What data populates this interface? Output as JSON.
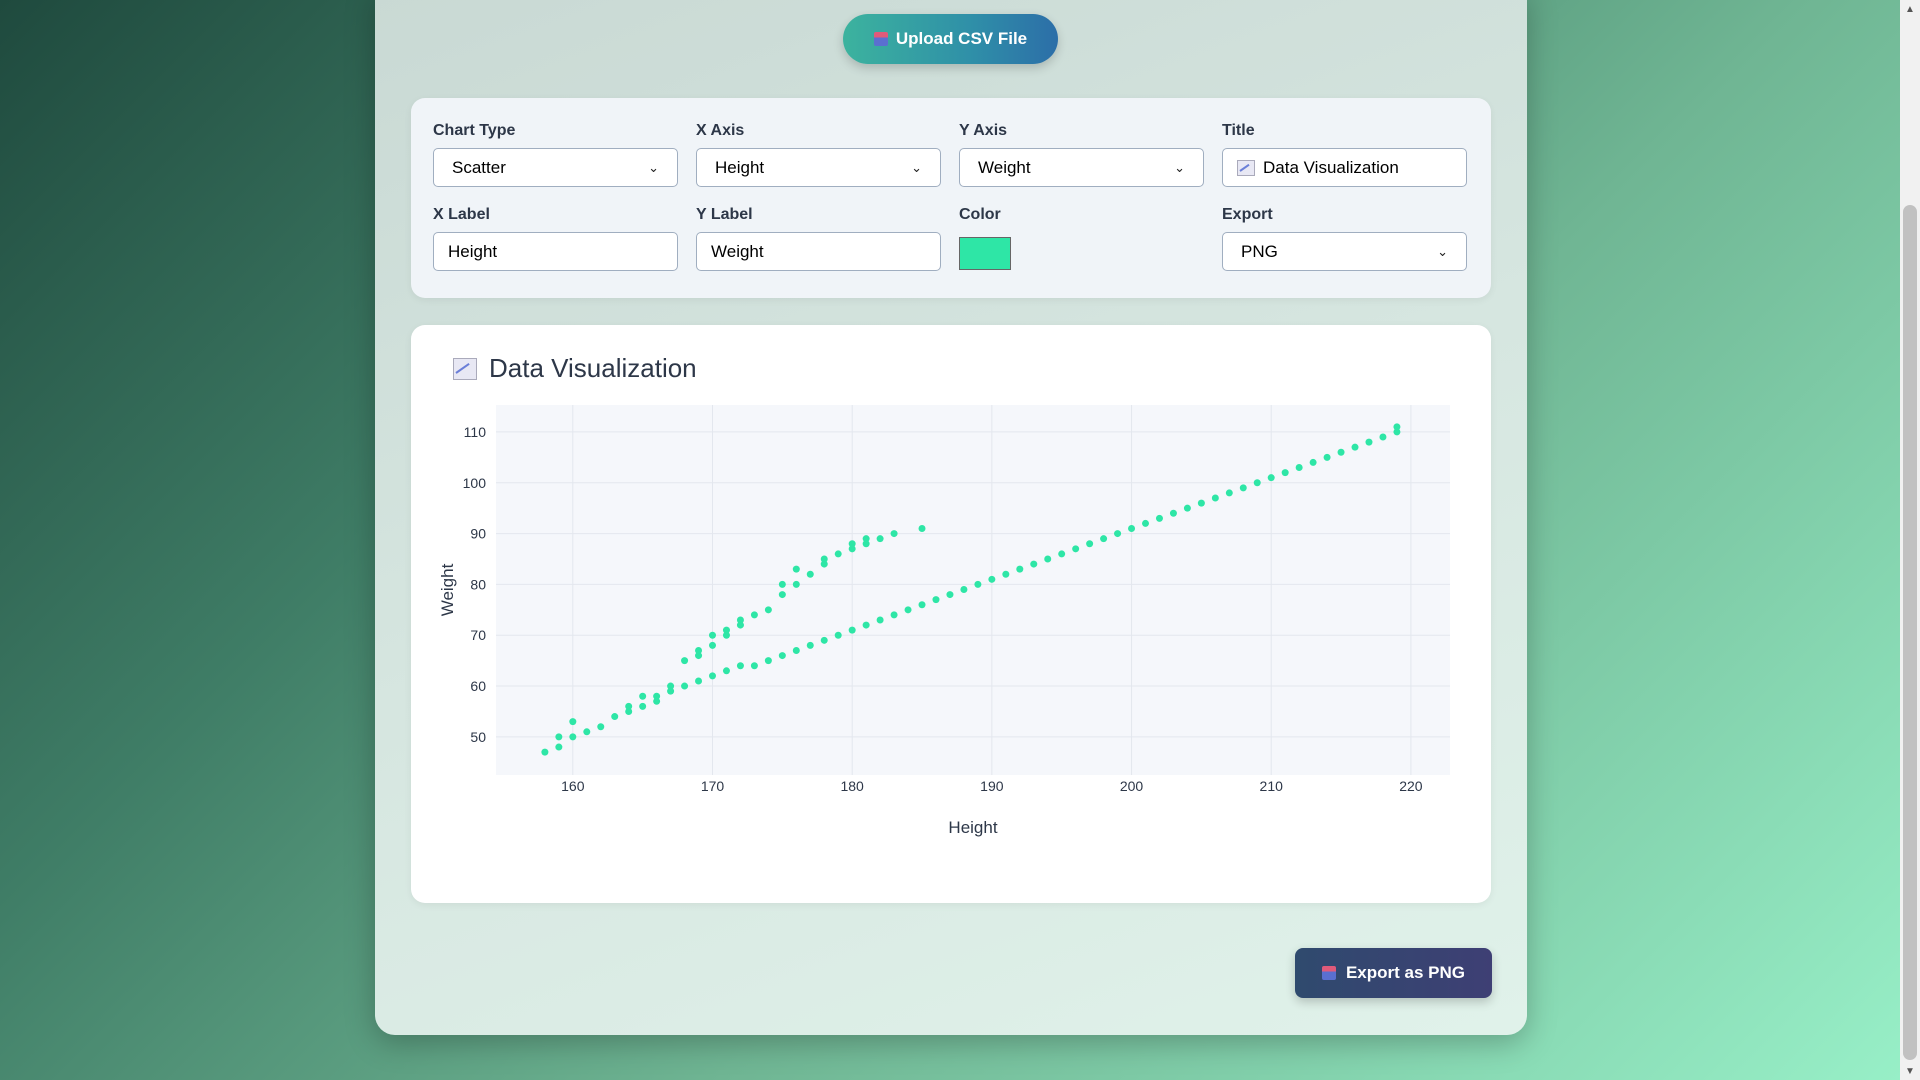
{
  "upload": {
    "label": "Upload CSV File"
  },
  "controls": {
    "chart_type": {
      "label": "Chart Type",
      "value": "Scatter"
    },
    "x_axis": {
      "label": "X Axis",
      "value": "Height"
    },
    "y_axis": {
      "label": "Y Axis",
      "value": "Weight"
    },
    "title": {
      "label": "Title",
      "value": "Data Visualization"
    },
    "x_label": {
      "label": "X Label",
      "value": "Height"
    },
    "y_label": {
      "label": "Y Label",
      "value": "Weight"
    },
    "color": {
      "label": "Color",
      "value": "#2ee6a6"
    },
    "export": {
      "label": "Export",
      "value": "PNG"
    }
  },
  "export_button": {
    "label": "Export as PNG"
  },
  "chart_data": {
    "type": "scatter",
    "title": "Data Visualization",
    "xlabel": "Height",
    "ylabel": "Weight",
    "xlim": [
      154.5,
      222.8
    ],
    "ylim": [
      42.5,
      115.3
    ],
    "x_ticks": [
      160,
      170,
      180,
      190,
      200,
      210,
      220
    ],
    "y_ticks": [
      50,
      60,
      70,
      80,
      90,
      100,
      110
    ],
    "grid": true,
    "color": "#2ee6a6",
    "series": [
      {
        "points": [
          [
            158,
            47
          ],
          [
            159,
            48
          ],
          [
            159,
            50
          ],
          [
            160,
            50
          ],
          [
            160,
            53
          ],
          [
            161,
            51
          ],
          [
            162,
            52
          ],
          [
            163,
            54
          ],
          [
            164,
            55
          ],
          [
            164,
            56
          ],
          [
            165,
            56
          ],
          [
            165,
            58
          ],
          [
            166,
            57
          ],
          [
            166,
            58
          ],
          [
            167,
            59
          ],
          [
            167,
            60
          ],
          [
            168,
            60
          ],
          [
            168,
            65
          ],
          [
            169,
            61
          ],
          [
            169,
            66
          ],
          [
            169,
            67
          ],
          [
            170,
            62
          ],
          [
            170,
            68
          ],
          [
            170,
            70
          ],
          [
            171,
            63
          ],
          [
            171,
            70
          ],
          [
            171,
            71
          ],
          [
            172,
            64
          ],
          [
            172,
            72
          ],
          [
            172,
            73
          ],
          [
            173,
            64
          ],
          [
            173,
            74
          ],
          [
            174,
            65
          ],
          [
            174,
            75
          ],
          [
            175,
            66
          ],
          [
            175,
            78
          ],
          [
            175,
            80
          ],
          [
            176,
            67
          ],
          [
            176,
            80
          ],
          [
            176,
            83
          ],
          [
            177,
            68
          ],
          [
            177,
            82
          ],
          [
            178,
            69
          ],
          [
            178,
            84
          ],
          [
            178,
            85
          ],
          [
            179,
            70
          ],
          [
            179,
            86
          ],
          [
            180,
            71
          ],
          [
            180,
            87
          ],
          [
            180,
            88
          ],
          [
            181,
            72
          ],
          [
            181,
            88
          ],
          [
            181,
            89
          ],
          [
            182,
            73
          ],
          [
            182,
            89
          ],
          [
            183,
            74
          ],
          [
            183,
            90
          ],
          [
            184,
            75
          ],
          [
            185,
            76
          ],
          [
            185,
            91
          ],
          [
            186,
            77
          ],
          [
            187,
            78
          ],
          [
            188,
            79
          ],
          [
            189,
            80
          ],
          [
            190,
            81
          ],
          [
            191,
            82
          ],
          [
            192,
            83
          ],
          [
            193,
            84
          ],
          [
            194,
            85
          ],
          [
            195,
            86
          ],
          [
            196,
            87
          ],
          [
            197,
            88
          ],
          [
            198,
            89
          ],
          [
            199,
            90
          ],
          [
            200,
            91
          ],
          [
            201,
            92
          ],
          [
            202,
            93
          ],
          [
            203,
            94
          ],
          [
            204,
            95
          ],
          [
            205,
            96
          ],
          [
            206,
            97
          ],
          [
            207,
            98
          ],
          [
            208,
            99
          ],
          [
            209,
            100
          ],
          [
            210,
            101
          ],
          [
            211,
            102
          ],
          [
            212,
            103
          ],
          [
            213,
            104
          ],
          [
            214,
            105
          ],
          [
            215,
            106
          ],
          [
            216,
            107
          ],
          [
            217,
            108
          ],
          [
            218,
            109
          ],
          [
            219,
            110
          ],
          [
            219,
            111
          ]
        ]
      }
    ]
  }
}
